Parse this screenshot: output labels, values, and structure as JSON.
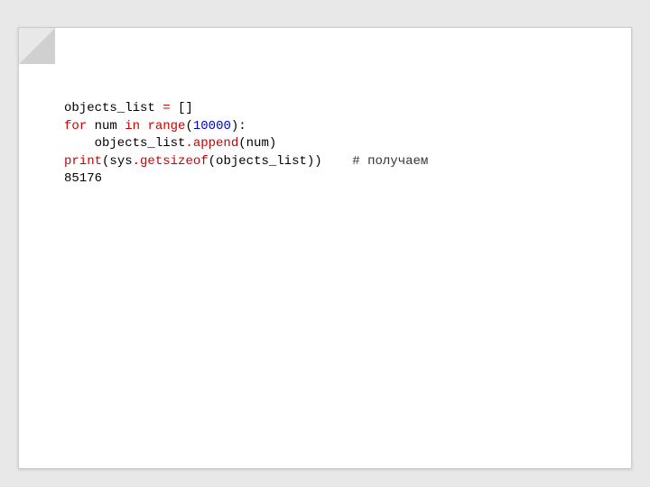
{
  "code": {
    "line1": {
      "t1": "objects_list ",
      "t2": "=",
      "t3": " []"
    },
    "line2": {
      "t1": "for",
      "t2": " num ",
      "t3": "in",
      "t4": " range",
      "t5": "(",
      "t6": "10000",
      "t7": "):"
    },
    "line3": {
      "t1": "    objects_list",
      "t2": ".",
      "t3": "append",
      "t4": "(num)"
    },
    "line4": {
      "t1": "print",
      "t2": "(sys",
      "t3": ".",
      "t4": "getsizeof",
      "t5": "(objects_list))    ",
      "t6": "# получаем"
    },
    "line5": {
      "t1": "85176"
    }
  }
}
